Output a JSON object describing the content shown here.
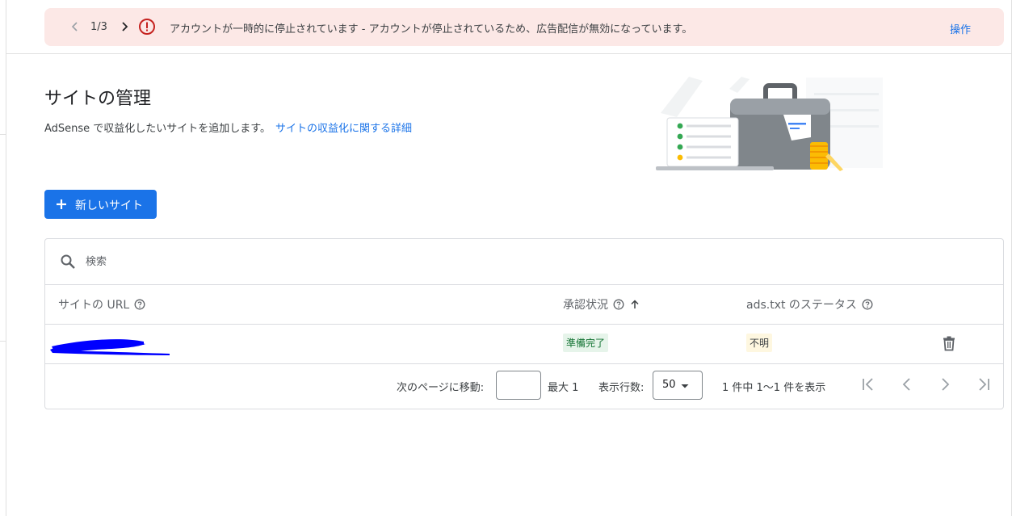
{
  "alert": {
    "counter": "1/3",
    "message": "アカウントが一時的に停止されています - アカウントが停止されているため、広告配信が無効になっています。",
    "action_label": "操作",
    "colors": {
      "background": "#fce8e6",
      "error_icon": "#c5221f",
      "link": "#1a73e8"
    }
  },
  "header": {
    "title": "サイトの管理",
    "description": "AdSense で収益化したいサイトを追加します。",
    "learn_more": "サイトの収益化に関する詳細"
  },
  "new_site_button": {
    "label": "新しいサイト",
    "icon": "plus-icon",
    "color": "#1a73e8"
  },
  "table": {
    "search_placeholder": "検索",
    "columns": [
      {
        "label": "サイトの URL",
        "help": true
      },
      {
        "label": "承認状況",
        "help": true,
        "sort": "ascending"
      },
      {
        "label": "ads.txt のステータス",
        "help": true
      }
    ],
    "rows": [
      {
        "url": "",
        "approval_status": "準備完了",
        "ads_txt_status": "不明",
        "action_icon": "trash-icon"
      }
    ]
  },
  "pagination": {
    "goto_label": "次のページに移動:",
    "goto_value": "",
    "max_label": "最大 1",
    "rows_label": "表示行数:",
    "rows_value": "50",
    "range_text": "1 件中 1～1 件を表示"
  }
}
